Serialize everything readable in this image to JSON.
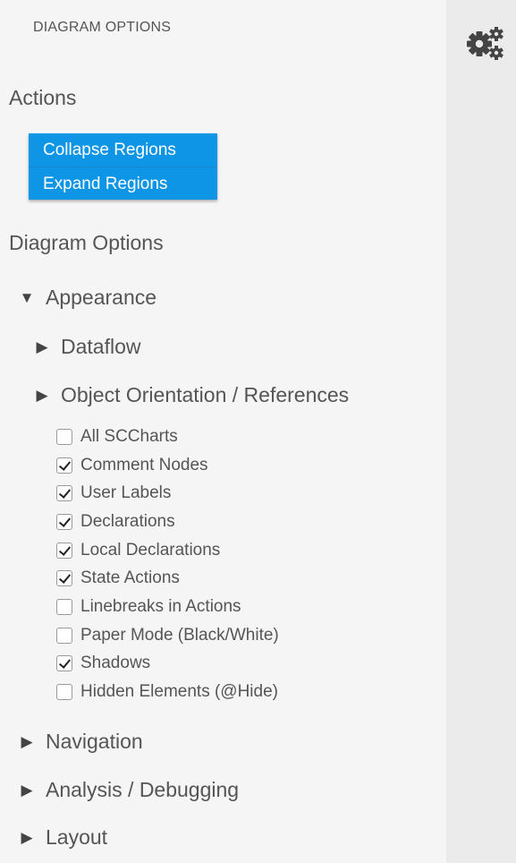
{
  "header": {
    "title": "DIAGRAM OPTIONS"
  },
  "actions": {
    "title": "Actions",
    "buttons": [
      {
        "label": "Collapse Regions"
      },
      {
        "label": "Expand Regions"
      }
    ]
  },
  "diagram_options": {
    "title": "Diagram Options",
    "appearance": {
      "label": "Appearance",
      "expanded": true,
      "dataflow": {
        "label": "Dataflow",
        "expanded": false
      },
      "object_orientation": {
        "label": "Object Orientation / References",
        "expanded": false
      },
      "options": [
        {
          "label": "All SCCharts",
          "checked": false
        },
        {
          "label": "Comment Nodes",
          "checked": true
        },
        {
          "label": "User Labels",
          "checked": true
        },
        {
          "label": "Declarations",
          "checked": true
        },
        {
          "label": "Local Declarations",
          "checked": true
        },
        {
          "label": "State Actions",
          "checked": true
        },
        {
          "label": "Linebreaks in Actions",
          "checked": false
        },
        {
          "label": "Paper Mode (Black/White)",
          "checked": false
        },
        {
          "label": "Shadows",
          "checked": true
        },
        {
          "label": "Hidden Elements (@Hide)",
          "checked": false
        }
      ]
    },
    "navigation": {
      "label": "Navigation",
      "expanded": false
    },
    "analysis": {
      "label": "Analysis / Debugging",
      "expanded": false
    },
    "layout": {
      "label": "Layout",
      "expanded": false
    }
  },
  "icons": {
    "expanded": "triangle-down-icon",
    "collapsed": "triangle-right-icon",
    "options_toggle": "gears-icon"
  },
  "colors": {
    "panel_background": "#f5f5f5",
    "side_strip": "#ebebeb",
    "button_blue": "#0e95e6",
    "text": "#555555"
  }
}
